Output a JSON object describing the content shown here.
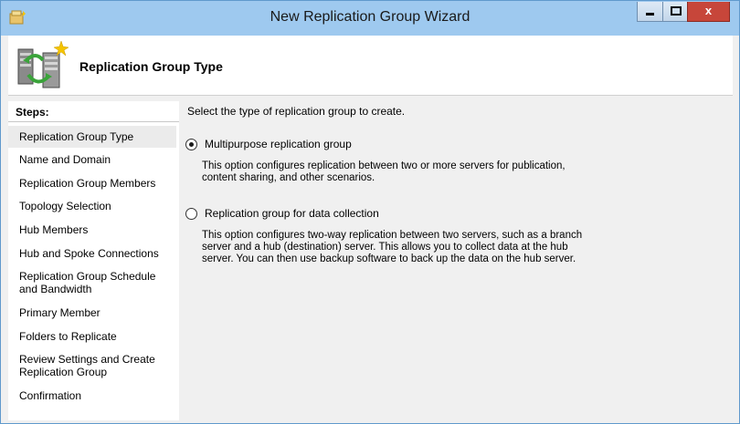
{
  "window": {
    "title": "New Replication Group Wizard",
    "controls": {
      "minimize": "",
      "maximize": "",
      "close": "x"
    }
  },
  "header": {
    "title": "Replication Group Type"
  },
  "steps": {
    "heading": "Steps:",
    "items": [
      {
        "label": "Replication Group Type",
        "selected": true
      },
      {
        "label": "Name and Domain"
      },
      {
        "label": "Replication Group Members"
      },
      {
        "label": "Topology Selection"
      },
      {
        "label": "Hub Members"
      },
      {
        "label": "Hub and Spoke Connections"
      },
      {
        "label": "Replication Group Schedule and Bandwidth"
      },
      {
        "label": "Primary Member"
      },
      {
        "label": "Folders to Replicate"
      },
      {
        "label": "Review Settings and Create Replication Group"
      },
      {
        "label": "Confirmation"
      }
    ]
  },
  "main": {
    "intro": "Select the type of replication group to create.",
    "options": [
      {
        "label": "Multipurpose replication group",
        "checked": true,
        "description": "This option configures replication between two or more servers for publication, content sharing, and other scenarios."
      },
      {
        "label": "Replication group for data collection",
        "checked": false,
        "description": "This option configures two-way replication between two servers, such as a branch server and a hub (destination) server. This allows you to collect data at the hub server. You can then use backup software to back up the data on the hub server."
      }
    ]
  },
  "colors": {
    "titlebar": "#9ec9ef",
    "close_button": "#c7463a",
    "selected_step": "#ebebeb"
  }
}
